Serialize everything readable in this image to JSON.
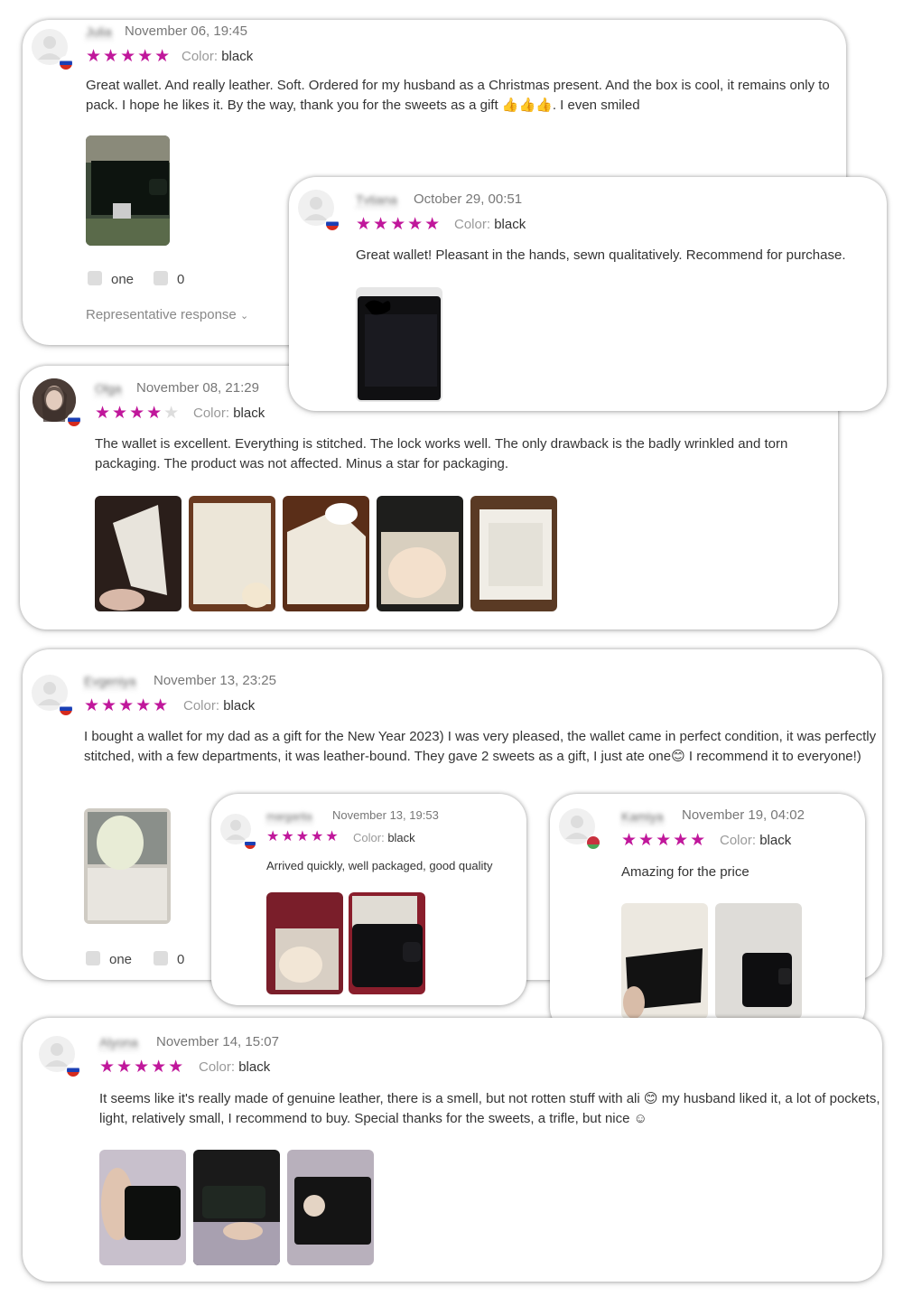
{
  "reviews": [
    {
      "name": "Julia",
      "date": "November 06, 19:45",
      "stars": "★★★★★",
      "color_label": "Color:",
      "color_value": "black",
      "text": "Great wallet. And really leather. Soft. Ordered for my husband as a Christmas present. And the box is cool, it remains only to pack. I hope he likes it. By the way, thank you for the sweets as a gift 👍👍👍. I even smiled",
      "likes": "one",
      "dislikes": "0",
      "representative": "Representative response"
    },
    {
      "name": "Tvtiana",
      "date": "October 29, 00:51",
      "stars": "★★★★★",
      "color_label": "Color:",
      "color_value": "black",
      "text": "Great wallet! Pleasant in the hands, sewn qualitatively. Recommend for purchase."
    },
    {
      "name": "Olga",
      "date": "November 08, 21:29",
      "stars": "★★★★",
      "stars_off": "★",
      "color_label": "Color:",
      "color_value": "black",
      "text": "The wallet is excellent. Everything is stitched. The lock works well. The only drawback is the badly wrinkled and torn packaging. The product was not affected. Minus a star for packaging."
    },
    {
      "name": "Evgeniya",
      "date": "November 13, 23:25",
      "stars": "★★★★★",
      "color_label": "Color:",
      "color_value": "black",
      "text": "I bought a wallet for my dad as a gift for the New Year 2023) I was very pleased, the wallet came in perfect condition, it was perfectly stitched, with a few departments, it was leather-bound. They gave 2 sweets as a gift, I just ate one😊 I recommend it to everyone!)",
      "likes": "one",
      "dislikes": "0"
    },
    {
      "name": "margarita",
      "date": "November 13, 19:53",
      "stars": "★★★★★",
      "color_label": "Color:",
      "color_value": "black",
      "text": "Arrived quickly, well packaged, good quality"
    },
    {
      "name": "Kamiya",
      "date": "November 19, 04:02",
      "stars": "★★★★★",
      "color_label": "Color:",
      "color_value": "black",
      "text": "Amazing for the price"
    },
    {
      "name": "Alyona",
      "date": "November 14, 15:07",
      "stars": "★★★★★",
      "color_label": "Color:",
      "color_value": "black",
      "text": "It seems like it's really made of genuine leather, there is a smell, but not rotten stuff with ali 😊 my husband liked it, a lot of pockets, light, relatively small, I recommend to buy. Special thanks for the sweets, a trifle, but nice ☺"
    }
  ],
  "colors": {
    "star": "#c0179b",
    "star_off": "#dddddd"
  }
}
